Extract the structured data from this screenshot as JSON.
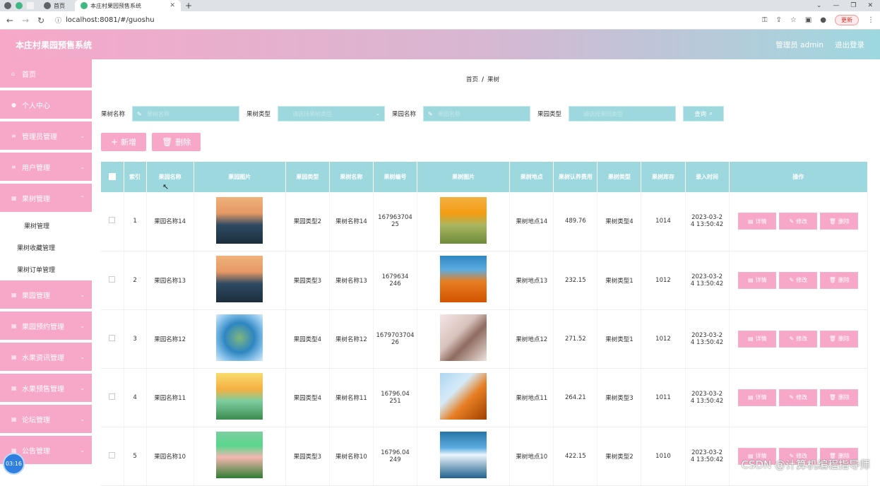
{
  "browser": {
    "tabs": [
      {
        "title": "首页",
        "active": false
      },
      {
        "title": "本庄村果园预售系统",
        "active": true
      }
    ],
    "url": "localhost:8081/#/guoshu",
    "update_label": "更新"
  },
  "header": {
    "title": "本庄村果园预售系统",
    "user": "管理员 admin",
    "logout": "退出登录"
  },
  "sidebar": {
    "menus": [
      {
        "label": "首页",
        "icon": "home-icon"
      },
      {
        "label": "个人中心",
        "icon": "user-icon"
      },
      {
        "label": "管理员管理",
        "icon": "list-icon"
      },
      {
        "label": "用户管理",
        "icon": "list-icon"
      },
      {
        "label": "果树管理",
        "icon": "grid-icon"
      }
    ],
    "submenus": [
      "果树管理",
      "果树收藏管理",
      "果树订单管理"
    ],
    "menus2": [
      {
        "label": "果园管理",
        "icon": "grid-icon"
      },
      {
        "label": "果园预约管理",
        "icon": "grid-icon"
      },
      {
        "label": "水果资讯管理",
        "icon": "grid-icon"
      },
      {
        "label": "水果预售管理",
        "icon": "grid-icon"
      },
      {
        "label": "论坛管理",
        "icon": "grid-icon"
      },
      {
        "label": "公告管理",
        "icon": "grid-icon"
      }
    ]
  },
  "breadcrumb": {
    "home": "首页",
    "current": "果树"
  },
  "search": {
    "fields": [
      {
        "label": "果树名称",
        "placeholder": "果树名称"
      },
      {
        "label": "果树类型",
        "placeholder": "请选择果树类型"
      },
      {
        "label": "果园名称",
        "placeholder": "果园名称"
      },
      {
        "label": "果园类型",
        "placeholder": "请选择果园类型"
      }
    ],
    "query_label": "查询"
  },
  "actions": {
    "add_label": "新增",
    "delete_label": "删除"
  },
  "table": {
    "columns": [
      "索引",
      "果园名称",
      "果园图片",
      "果园类型",
      "果树名称",
      "果树编号",
      "果树图片",
      "果树地点",
      "果树认养费用",
      "果树类型",
      "果树库存",
      "录入时间",
      "操作"
    ],
    "row_buttons": {
      "detail": "详情",
      "edit": "修改",
      "delete": "删除"
    },
    "rows": [
      {
        "index": "1",
        "orchard": "果园名称14",
        "orchard_img": "sunset-lake",
        "orchard_type": "果园类型2",
        "tree": "果树名称14",
        "code_1": "167963704",
        "code_2": "25",
        "tree_img": "flower-field",
        "place": "果树地点14",
        "fee": "489.76",
        "tree_type": "果树类型4",
        "stock": "1014",
        "time_1": "2023-03-2",
        "time_2": "4 13:50:42"
      },
      {
        "index": "2",
        "orchard": "果园名称13",
        "orchard_img": "sunset-lake",
        "orchard_type": "果园类型3",
        "tree": "果树名称13",
        "code_1": "1679634",
        "code_2": "246",
        "tree_img": "orange-mountain",
        "place": "果树地点13",
        "fee": "232.15",
        "tree_type": "果树类型1",
        "stock": "1012",
        "time_1": "2023-03-2",
        "time_2": "4 13:50:42"
      },
      {
        "index": "3",
        "orchard": "果园名称12",
        "orchard_img": "tiny-planet",
        "orchard_type": "果园类型4",
        "tree": "果树名称12",
        "code_1": "1679703704",
        "code_2": "26",
        "tree_img": "blossom-branch",
        "place": "果树地点12",
        "fee": "271.52",
        "tree_type": "果树类型1",
        "stock": "1012",
        "time_1": "2023-03-2",
        "time_2": "4 13:50:42"
      },
      {
        "index": "4",
        "orchard": "果园名称11",
        "orchard_img": "daisy-meadow",
        "orchard_type": "果园类型4",
        "tree": "果树名称11",
        "code_1": "16796.04",
        "code_2": "251",
        "tree_img": "autumn-leaves",
        "place": "果树地点11",
        "fee": "264.21",
        "tree_type": "果树类型3",
        "stock": "1011",
        "time_1": "2023-03-2",
        "time_2": "4 13:50:42"
      },
      {
        "index": "5",
        "orchard": "果园名称10",
        "orchard_img": "lotus",
        "orchard_type": "果园类型3",
        "tree": "果树名称10",
        "code_1": "16796.04",
        "code_2": "249",
        "tree_img": "ocean-sky",
        "place": "果树地点10",
        "fee": "422.15",
        "tree_type": "果树类型2",
        "stock": "1010",
        "time_1": "2023-03-2",
        "time_2": "4 13:50:42"
      }
    ]
  },
  "overlay": {
    "timer": "03:16",
    "watermark": "CSDN @计算机编程指导师"
  },
  "colors": {
    "pink": "#f7a8c8",
    "teal": "#9ed8df"
  }
}
